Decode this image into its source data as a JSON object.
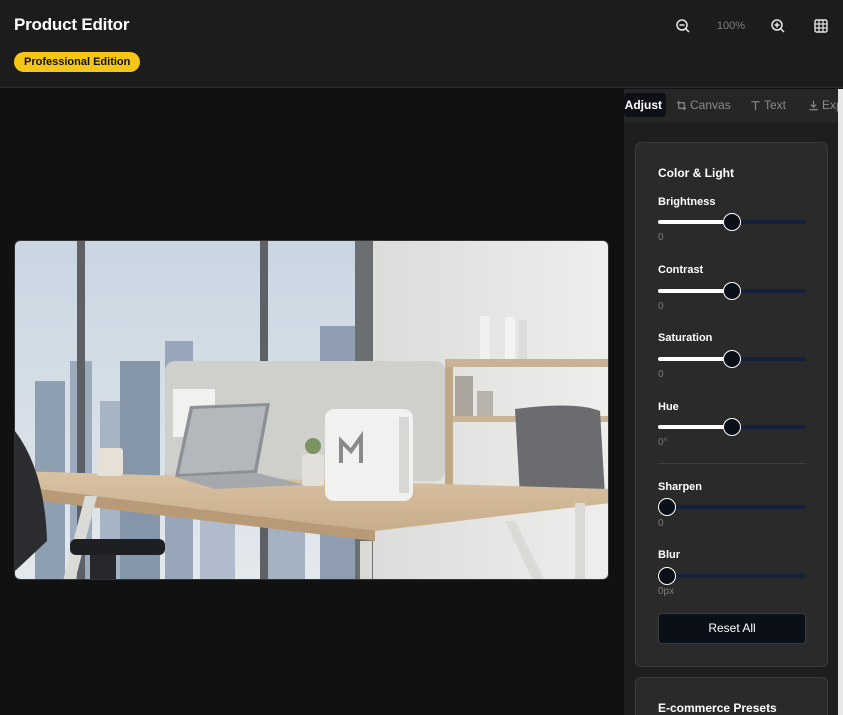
{
  "header": {
    "title": "Product Editor",
    "badge": "Professional Edition",
    "zoom_level": "100%"
  },
  "icons": {
    "zoom_out": "zoom-out-icon",
    "zoom_in": "zoom-in-icon",
    "grid": "grid-icon",
    "canvas": "crop-icon",
    "text": "text-icon",
    "export": "download-icon"
  },
  "colors": {
    "badge_bg": "#f5c518",
    "panel_bg": "#1e1e1e",
    "card_bg": "#2a2a2a",
    "slider_track": "#15203a",
    "button_bg": "#0b0f17"
  },
  "tabs": [
    {
      "label": "Adjust",
      "active": true
    },
    {
      "label": "Canvas",
      "active": false
    },
    {
      "label": "Text",
      "active": false
    },
    {
      "label": "Exp",
      "active": false
    }
  ],
  "adjust": {
    "section_title": "Color & Light",
    "controls": [
      {
        "label": "Brightness",
        "value": "0",
        "level": 0.5
      },
      {
        "label": "Contrast",
        "value": "0",
        "level": 0.5
      },
      {
        "label": "Saturation",
        "value": "0",
        "level": 0.5
      },
      {
        "label": "Hue",
        "value": "0°",
        "level": 0.5
      },
      {
        "label": "Sharpen",
        "value": "0",
        "level": 0.0
      },
      {
        "label": "Blur",
        "value": "0px",
        "level": 0.0
      }
    ],
    "reset_label": "Reset All"
  },
  "presets": {
    "title": "E-commerce Presets"
  }
}
